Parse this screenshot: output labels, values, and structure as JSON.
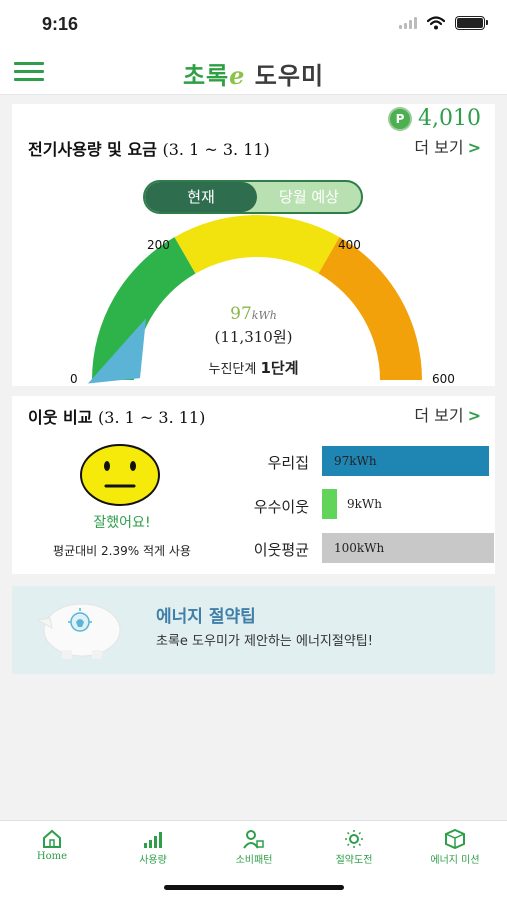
{
  "status": {
    "time": "9:16"
  },
  "header": {
    "logo_part1": "초록",
    "logo_e": "e",
    "logo_part2": "도우미"
  },
  "points": {
    "icon": "P",
    "value": "4,010"
  },
  "usage": {
    "title": "전기사용량 및 요금",
    "range": "(3. 1 ~ 3. 11)",
    "more": "더 보기",
    "toggle_current": "현재",
    "toggle_forecast": "당월 예상",
    "kwh_value": "97",
    "kwh_unit": "kWh",
    "won": "(11,310원)",
    "stage_label": "누진단계",
    "stage_value": "1단계",
    "ticks": [
      "0",
      "200",
      "400",
      "600"
    ],
    "gauge_value": 97,
    "gauge_max": 600,
    "colors": {
      "green": "#2db34a",
      "yellow": "#f2e30f",
      "orange": "#f2a10a",
      "needle": "#5bb4d6"
    }
  },
  "neighbor": {
    "title": "이웃 비교",
    "range": "(3. 1 ~ 3. 11)",
    "more": "더 보기",
    "good_text": "잘했어요!",
    "avg_text": "평균대비 2.39% 적게 사용",
    "rows": [
      {
        "label": "우리집",
        "value": "97kWh",
        "kwh": 97,
        "color": "#1f86b3"
      },
      {
        "label": "우수이웃",
        "value": "9kWh",
        "kwh": 9,
        "color": "#63d45a"
      },
      {
        "label": "이웃평균",
        "value": "100kWh",
        "kwh": 100,
        "color": "#c8c8c8"
      }
    ]
  },
  "tip": {
    "title": "에너지 절약팁",
    "subtitle": "초록e 도우미가 제안하는 에너지절약팁!"
  },
  "tabs": [
    {
      "label": "Home",
      "icon": "home-icon"
    },
    {
      "label": "사용량",
      "icon": "bar-chart-icon"
    },
    {
      "label": "소비패턴",
      "icon": "person-pattern-icon"
    },
    {
      "label": "절약도전",
      "icon": "sun-icon"
    },
    {
      "label": "에너지 미션",
      "icon": "cube-mission-icon"
    }
  ]
}
